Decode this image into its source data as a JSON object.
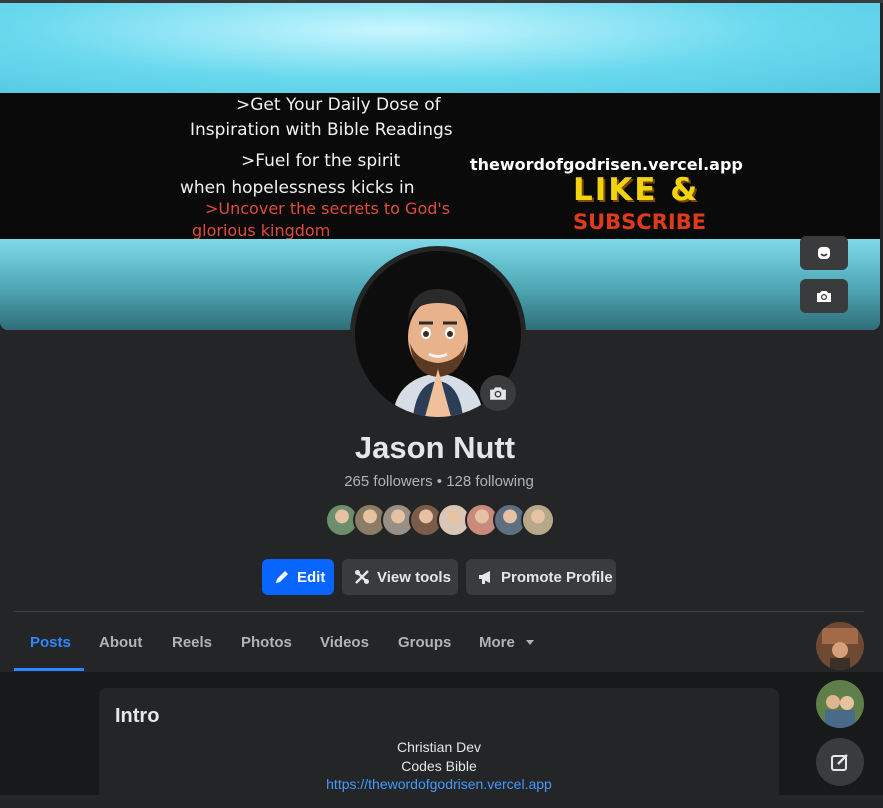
{
  "cover": {
    "lines": [
      ">Get Your Daily Dose of",
      "Inspiration with Bible Readings",
      ">Fuel for the spirit",
      "when hopelessness kicks in",
      ">Uncover the secrets to God's",
      "glorious kingdom"
    ],
    "site": "thewordofgodrisen.vercel.app",
    "like": "LIKE &",
    "subscribe": "SUBSCRIBE"
  },
  "profile": {
    "name": "Jason Nutt",
    "followers": "265 followers",
    "separator": "•",
    "following": "128 following"
  },
  "friends_colors": [
    "#6b8f6a",
    "#8a7d64",
    "#9a8f86",
    "#7b5c49",
    "#d8c7b9",
    "#c98a7e",
    "#5d6f80",
    "#b7a88a"
  ],
  "actions": {
    "edit": "Edit",
    "view_tools": "View tools",
    "promote": "Promote Profile"
  },
  "tabs": [
    "Posts",
    "About",
    "Reels",
    "Photos",
    "Videos",
    "Groups",
    "More"
  ],
  "intro": {
    "title": "Intro",
    "bio_line1": "Christian Dev",
    "bio_line2": "Codes Bible",
    "link": "https://thewordofgodrisen.vercel.app"
  },
  "colors": {
    "accent": "#0866ff",
    "active_tab": "#2d88ff",
    "background": "#242526"
  }
}
